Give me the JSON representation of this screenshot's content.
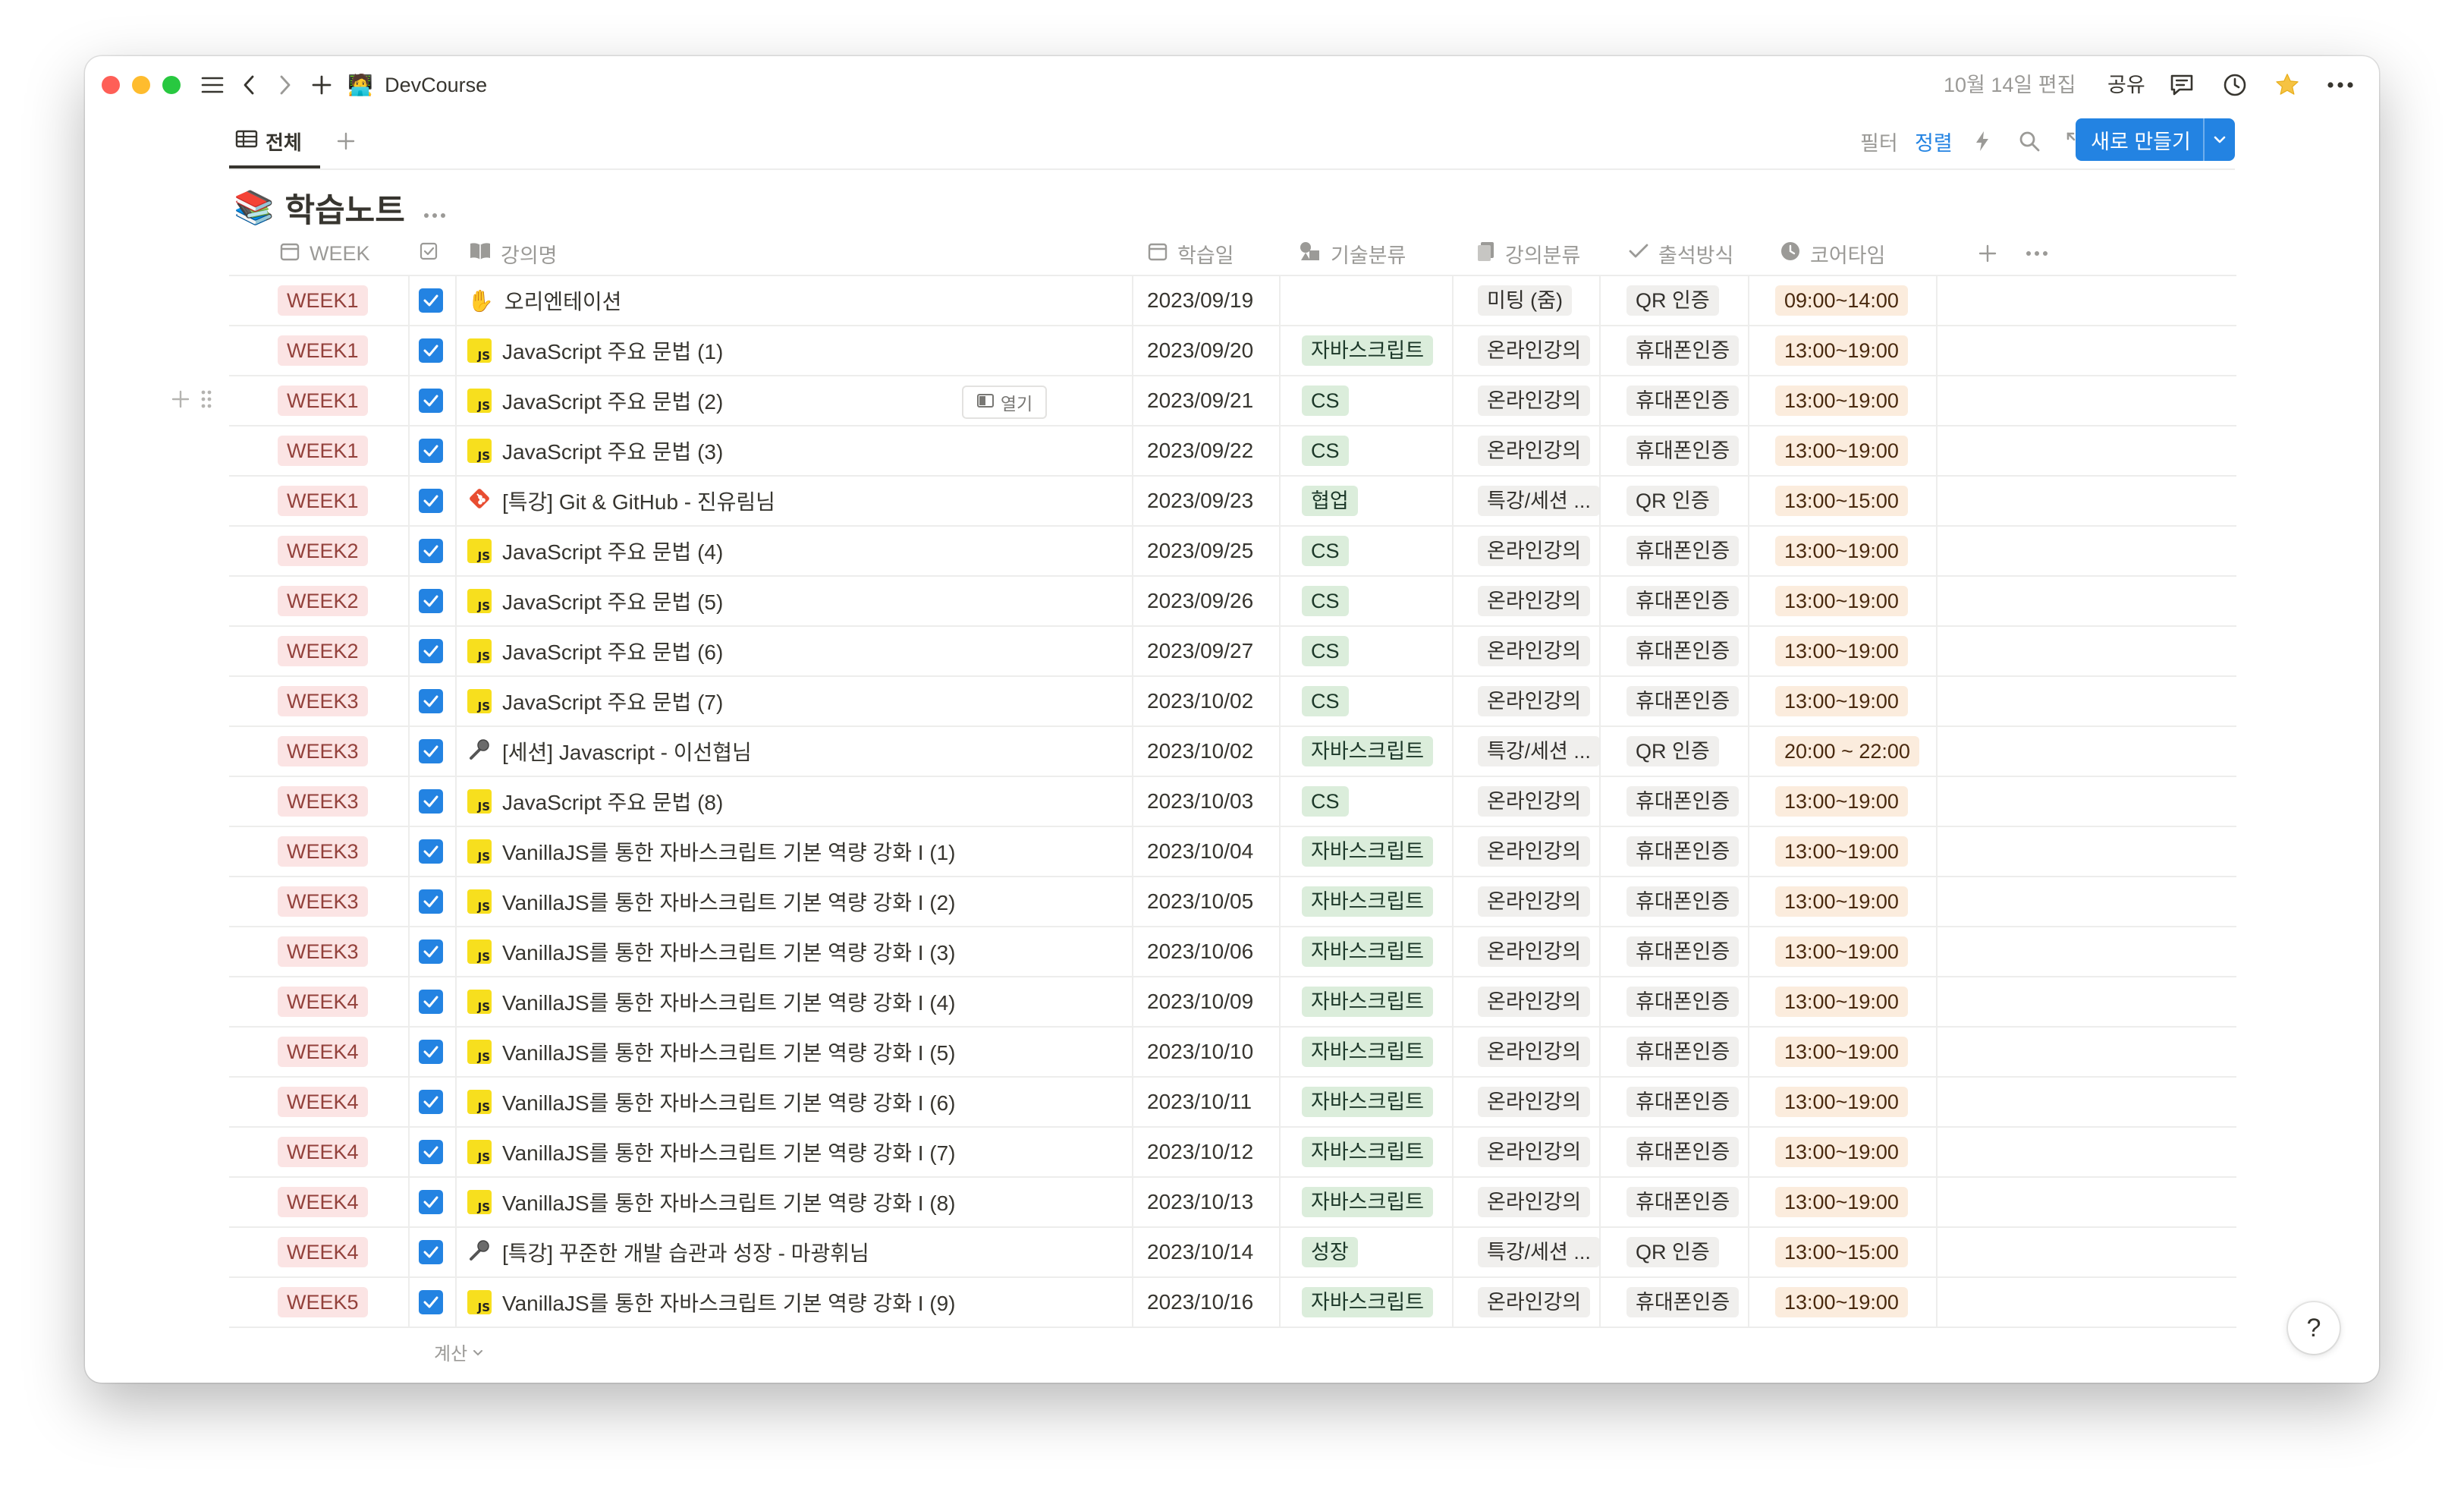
{
  "titlebar": {
    "workspace_emoji": "🧑‍💻",
    "workspace_name": "DevCourse",
    "edited": "10월 14일 편집",
    "share": "공유"
  },
  "view": {
    "tab_label": "전체",
    "filter": "필터",
    "sort": "정렬",
    "new_button": "새로 만들기"
  },
  "database": {
    "icon": "📚",
    "title": "학습노트"
  },
  "columns": {
    "week": "WEEK",
    "name": "강의명",
    "date": "학습일",
    "tech": "기술분류",
    "lecture_type": "강의분류",
    "attendance": "출석방식",
    "core_time": "코어타임"
  },
  "open_label": "열기",
  "calc_label": "계산",
  "help_label": "?",
  "rows": [
    {
      "week": "WEEK1",
      "icon": "✋",
      "name": "오리엔테이션",
      "date": "2023/09/19",
      "tech": "",
      "ltype": "미팅 (줌)",
      "att": "QR 인증",
      "time": "09:00~14:00"
    },
    {
      "week": "WEEK1",
      "icon": "js",
      "name": "JavaScript 주요 문법 (1)",
      "date": "2023/09/20",
      "tech": "자바스크립트",
      "ltype": "온라인강의",
      "att": "휴대폰인증",
      "time": "13:00~19:00"
    },
    {
      "week": "WEEK1",
      "icon": "js",
      "name": "JavaScript 주요 문법 (2)",
      "date": "2023/09/21",
      "tech": "CS",
      "ltype": "온라인강의",
      "att": "휴대폰인증",
      "time": "13:00~19:00"
    },
    {
      "week": "WEEK1",
      "icon": "js",
      "name": "JavaScript 주요 문법 (3)",
      "date": "2023/09/22",
      "tech": "CS",
      "ltype": "온라인강의",
      "att": "휴대폰인증",
      "time": "13:00~19:00"
    },
    {
      "week": "WEEK1",
      "icon": "git",
      "name": "[특강] Git & GitHub - 진유림님",
      "date": "2023/09/23",
      "tech": "협업",
      "ltype": "특강/세션 ...",
      "att": "QR 인증",
      "time": "13:00~15:00"
    },
    {
      "week": "WEEK2",
      "icon": "js",
      "name": "JavaScript 주요 문법 (4)",
      "date": "2023/09/25",
      "tech": "CS",
      "ltype": "온라인강의",
      "att": "휴대폰인증",
      "time": "13:00~19:00"
    },
    {
      "week": "WEEK2",
      "icon": "js",
      "name": "JavaScript 주요 문법 (5)",
      "date": "2023/09/26",
      "tech": "CS",
      "ltype": "온라인강의",
      "att": "휴대폰인증",
      "time": "13:00~19:00"
    },
    {
      "week": "WEEK2",
      "icon": "js",
      "name": "JavaScript 주요 문법 (6)",
      "date": "2023/09/27",
      "tech": "CS",
      "ltype": "온라인강의",
      "att": "휴대폰인증",
      "time": "13:00~19:00"
    },
    {
      "week": "WEEK3",
      "icon": "js",
      "name": "JavaScript 주요 문법 (7)",
      "date": "2023/10/02",
      "tech": "CS",
      "ltype": "온라인강의",
      "att": "휴대폰인증",
      "time": "13:00~19:00"
    },
    {
      "week": "WEEK3",
      "icon": "mic",
      "name": "[세션] Javascript - 이선협님",
      "date": "2023/10/02",
      "tech": "자바스크립트",
      "ltype": "특강/세션 ...",
      "att": "QR 인증",
      "time": "20:00 ~ 22:00"
    },
    {
      "week": "WEEK3",
      "icon": "js",
      "name": "JavaScript 주요 문법 (8)",
      "date": "2023/10/03",
      "tech": "CS",
      "ltype": "온라인강의",
      "att": "휴대폰인증",
      "time": "13:00~19:00"
    },
    {
      "week": "WEEK3",
      "icon": "js",
      "name": "VanillaJS를 통한 자바스크립트 기본 역량 강화 I (1)",
      "date": "2023/10/04",
      "tech": "자바스크립트",
      "ltype": "온라인강의",
      "att": "휴대폰인증",
      "time": "13:00~19:00"
    },
    {
      "week": "WEEK3",
      "icon": "js",
      "name": "VanillaJS를 통한 자바스크립트 기본 역량 강화 I (2)",
      "date": "2023/10/05",
      "tech": "자바스크립트",
      "ltype": "온라인강의",
      "att": "휴대폰인증",
      "time": "13:00~19:00"
    },
    {
      "week": "WEEK3",
      "icon": "js",
      "name": "VanillaJS를 통한 자바스크립트 기본 역량 강화 I (3)",
      "date": "2023/10/06",
      "tech": "자바스크립트",
      "ltype": "온라인강의",
      "att": "휴대폰인증",
      "time": "13:00~19:00"
    },
    {
      "week": "WEEK4",
      "icon": "js",
      "name": "VanillaJS를 통한 자바스크립트 기본 역량 강화 I (4)",
      "date": "2023/10/09",
      "tech": "자바스크립트",
      "ltype": "온라인강의",
      "att": "휴대폰인증",
      "time": "13:00~19:00"
    },
    {
      "week": "WEEK4",
      "icon": "js",
      "name": "VanillaJS를 통한 자바스크립트 기본 역량 강화 I (5)",
      "date": "2023/10/10",
      "tech": "자바스크립트",
      "ltype": "온라인강의",
      "att": "휴대폰인증",
      "time": "13:00~19:00"
    },
    {
      "week": "WEEK4",
      "icon": "js",
      "name": "VanillaJS를 통한 자바스크립트 기본 역량 강화 I (6)",
      "date": "2023/10/11",
      "tech": "자바스크립트",
      "ltype": "온라인강의",
      "att": "휴대폰인증",
      "time": "13:00~19:00"
    },
    {
      "week": "WEEK4",
      "icon": "js",
      "name": "VanillaJS를 통한 자바스크립트 기본 역량 강화 I (7)",
      "date": "2023/10/12",
      "tech": "자바스크립트",
      "ltype": "온라인강의",
      "att": "휴대폰인증",
      "time": "13:00~19:00"
    },
    {
      "week": "WEEK4",
      "icon": "js",
      "name": "VanillaJS를 통한 자바스크립트 기본 역량 강화 I (8)",
      "date": "2023/10/13",
      "tech": "자바스크립트",
      "ltype": "온라인강의",
      "att": "휴대폰인증",
      "time": "13:00~19:00"
    },
    {
      "week": "WEEK4",
      "icon": "mic",
      "name": "[특강] 꾸준한 개발 습관과 성장 - 마광휘님",
      "date": "2023/10/14",
      "tech": "성장",
      "ltype": "특강/세션 ...",
      "att": "QR 인증",
      "time": "13:00~15:00"
    },
    {
      "week": "WEEK5",
      "icon": "js",
      "name": "VanillaJS를 통한 자바스크립트 기본 역량 강화 I (9)",
      "date": "2023/10/16",
      "tech": "자바스크립트",
      "ltype": "온라인강의",
      "att": "휴대폰인증",
      "time": "13:00~19:00"
    }
  ],
  "colors": {
    "accent": "#2383e2",
    "week_tag_bg": "#fbe4e4",
    "tech_tag_bg": "#dbeddb",
    "type_tag_bg": "#f0efed",
    "time_tag_bg": "#fbecdd"
  }
}
